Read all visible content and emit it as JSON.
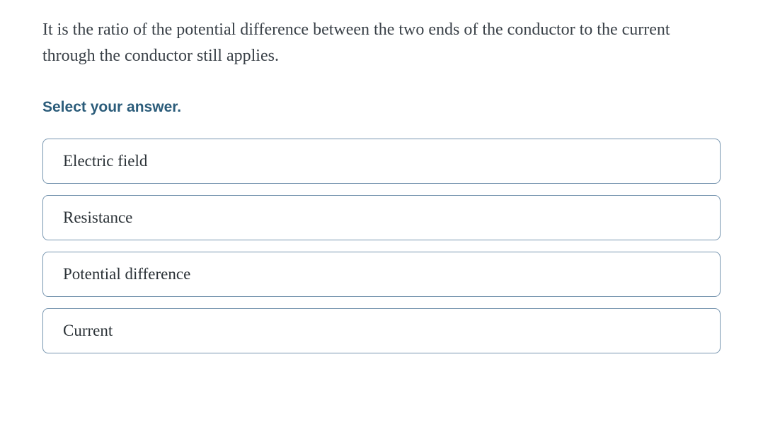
{
  "question": {
    "text": "It is the ratio of the potential difference between the two ends of the conductor to the current through the conductor still applies.",
    "instruction": "Select your answer."
  },
  "options": [
    {
      "label": "Electric field"
    },
    {
      "label": "Resistance"
    },
    {
      "label": "Potential difference"
    },
    {
      "label": "Current"
    }
  ]
}
